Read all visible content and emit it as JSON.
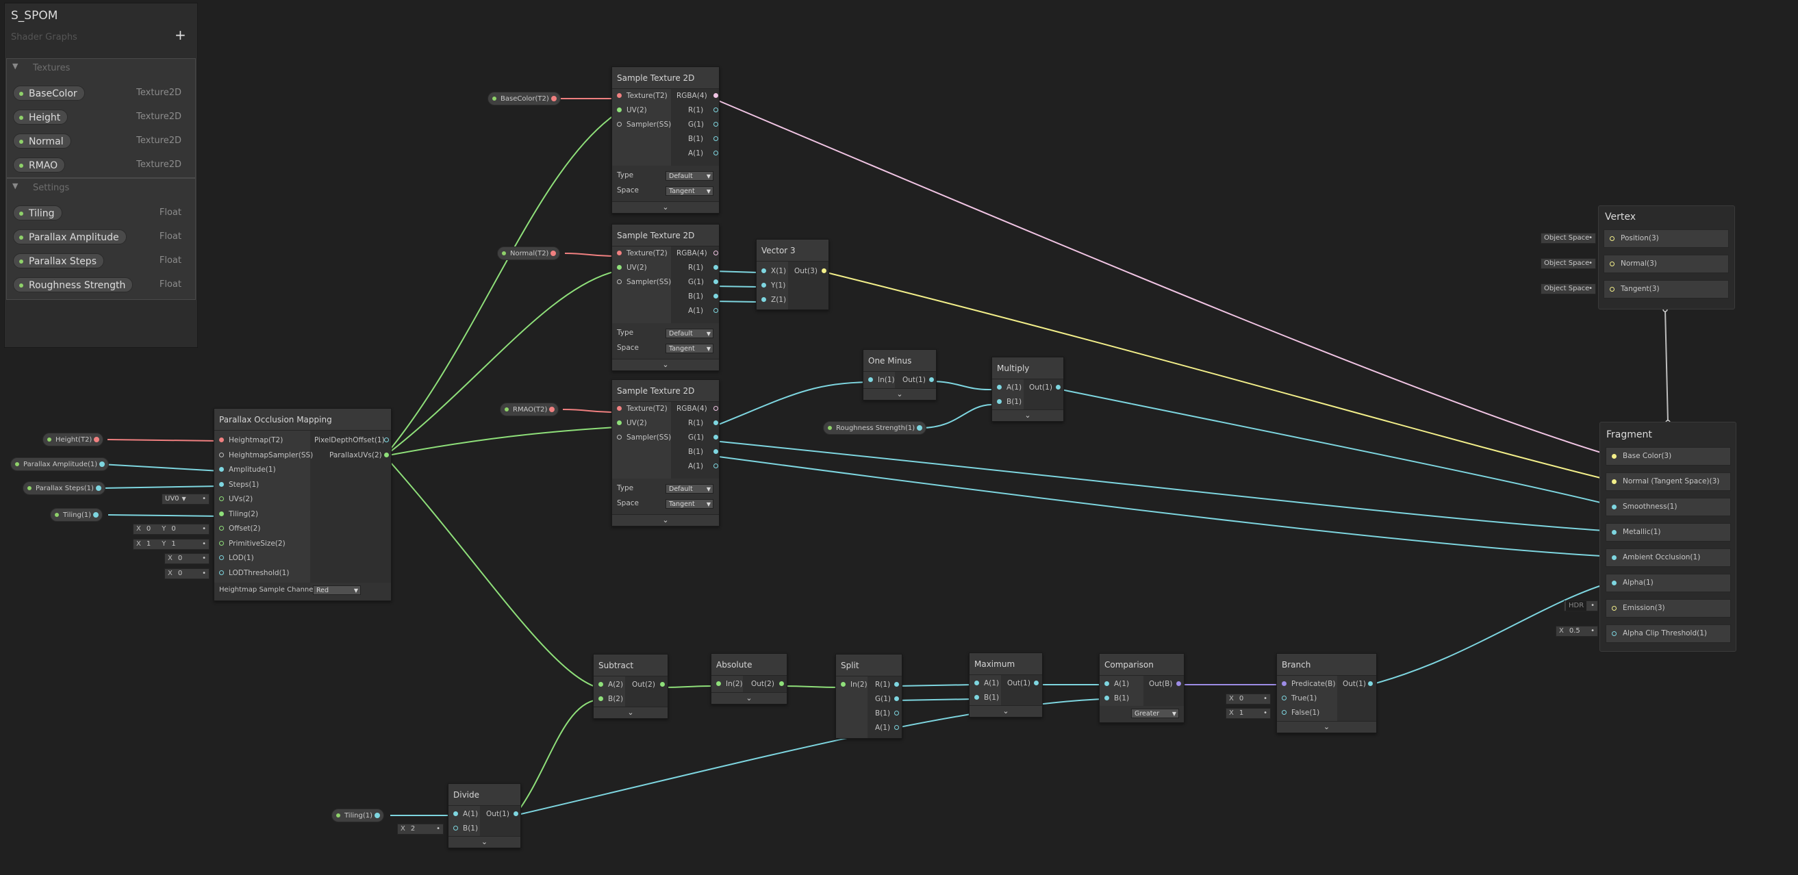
{
  "blackboard": {
    "title": "S_SPOM",
    "subtitle": "Shader Graphs",
    "add_label": "+",
    "sections": [
      {
        "name": "Textures",
        "items": [
          {
            "label": "BaseColor",
            "type": "Texture2D"
          },
          {
            "label": "Height",
            "type": "Texture2D"
          },
          {
            "label": "Normal",
            "type": "Texture2D"
          },
          {
            "label": "RMAO",
            "type": "Texture2D"
          }
        ]
      },
      {
        "name": "Settings",
        "items": [
          {
            "label": "Tiling",
            "type": "Float"
          },
          {
            "label": "Parallax Amplitude",
            "type": "Float"
          },
          {
            "label": "Parallax Steps",
            "type": "Float"
          },
          {
            "label": "Roughness Strength",
            "type": "Float"
          }
        ]
      }
    ]
  },
  "property_nodes": {
    "basecolor": "BaseColor(T2)",
    "normal": "Normal(T2)",
    "rmao": "RMAO(T2)",
    "height": "Height(T2)",
    "amp": "Parallax Amplitude(1)",
    "steps": "Parallax Steps(1)",
    "tiling1": "Tiling(1)",
    "rough": "Roughness Strength(1)",
    "tiling2": "Tiling(1)"
  },
  "sample_texture": {
    "title": "Sample Texture 2D",
    "inputs": [
      "Texture(T2)",
      "UV(2)",
      "Sampler(SS)"
    ],
    "outputs": [
      "RGBA(4)",
      "R(1)",
      "G(1)",
      "B(1)",
      "A(1)"
    ],
    "type_label": "Type",
    "space_label": "Space",
    "type_value": "Default",
    "space_value": "Tangent",
    "expand": "⌄"
  },
  "pom": {
    "title": "Parallax Occlusion Mapping",
    "inputs": [
      "Heightmap(T2)",
      "HeightmapSampler(SS)",
      "Amplitude(1)",
      "Steps(1)",
      "UVs(2)",
      "Tiling(2)",
      "Offset(2)",
      "PrimitiveSize(2)",
      "LOD(1)",
      "LODThreshold(1)"
    ],
    "outputs": [
      "PixelDepthOffset(1)",
      "ParallaxUVs(2)"
    ],
    "channel_label": "Heightmap Sample Channel",
    "channel_value": "Red",
    "uv_value": "UV0",
    "defaults": [
      {
        "x": "0",
        "y": "0"
      },
      {
        "x": "1",
        "y": "1"
      }
    ],
    "lod_values": [
      "0",
      "0"
    ]
  },
  "vector3": {
    "title": "Vector 3",
    "inputs": [
      "X(1)",
      "Y(1)",
      "Z(1)"
    ],
    "output": "Out(3)"
  },
  "one_minus": {
    "title": "One Minus",
    "input": "In(1)",
    "output": "Out(1)"
  },
  "multiply": {
    "title": "Multiply",
    "inputs": [
      "A(1)",
      "B(1)"
    ],
    "output": "Out(1)"
  },
  "subtract": {
    "title": "Subtract",
    "inputs": [
      "A(2)",
      "B(2)"
    ],
    "output": "Out(2)"
  },
  "absolute": {
    "title": "Absolute",
    "input": "In(2)",
    "output": "Out(2)"
  },
  "split": {
    "title": "Split",
    "input": "In(2)",
    "outputs": [
      "R(1)",
      "G(1)",
      "B(1)",
      "A(1)"
    ]
  },
  "maximum": {
    "title": "Maximum",
    "inputs": [
      "A(1)",
      "B(1)"
    ],
    "output": "Out(1)"
  },
  "comparison": {
    "title": "Comparison",
    "inputs": [
      "A(1)",
      "B(1)"
    ],
    "output": "Out(B)",
    "mode": "Greater"
  },
  "branch": {
    "title": "Branch",
    "inputs": [
      "Predicate(B)",
      "True(1)",
      "False(1)"
    ],
    "output": "Out(1)",
    "true_value": "0",
    "false_value": "1"
  },
  "divide": {
    "title": "Divide",
    "inputs": [
      "A(1)",
      "B(1)"
    ],
    "output": "Out(1)",
    "b_value": "2"
  },
  "vertex": {
    "title": "Vertex",
    "slots": [
      "Position(3)",
      "Normal(3)",
      "Tangent(3)"
    ],
    "space_label": "Object Space"
  },
  "fragment": {
    "title": "Fragment",
    "slots": [
      "Base Color(3)",
      "Normal (Tangent Space)(3)",
      "Smoothness(1)",
      "Metallic(1)",
      "Ambient Occlusion(1)",
      "Alpha(1)",
      "Emission(3)",
      "Alpha Clip Threshold(1)"
    ],
    "hdr_label": "HDR",
    "clip_value": "0.5"
  },
  "axis": {
    "x": "X",
    "y": "Y"
  },
  "colors": {
    "texture": "#f08080",
    "vector2": "#8fe07a",
    "float": "#7ed6e0",
    "vector3": "#f3ef8a",
    "vector4": "#f1c5e4",
    "boolean": "#9d8ce6"
  }
}
